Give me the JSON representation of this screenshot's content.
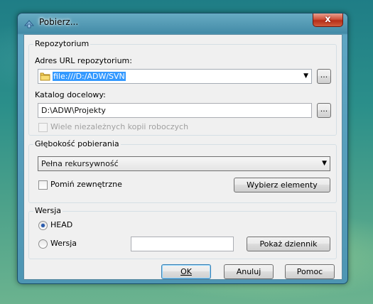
{
  "window": {
    "title": "Pobierz...",
    "close_glyph": "x"
  },
  "repository": {
    "group_label": "Repozytorium",
    "url_label": "Adres URL repozytorium:",
    "url_value": "file:///D:/ADW/SVN",
    "checkout_dir_label": "Katalog docelowy:",
    "checkout_dir_value": "D:\\ADW\\Projekty",
    "browse_glyph": "...",
    "multiple_copies_label": "Wiele niezależnych kopii roboczych"
  },
  "depth": {
    "group_label": "Głębokość pobierania",
    "selected": "Pełna rekursywność",
    "omit_externals_label": "Pomiń zewnętrzne",
    "choose_items_label": "Wybierz elementy"
  },
  "revision": {
    "group_label": "Wersja",
    "head_label": "HEAD",
    "revision_label": "Wersja",
    "revision_value": "",
    "show_log_label": "Pokaż dziennik"
  },
  "footer": {
    "ok_label": "OK",
    "cancel_label": "Anuluj",
    "help_label": "Pomoc"
  },
  "icons": {
    "title": "checkout-icon",
    "folder": "folder-icon",
    "dropdown": "chevron-down-icon"
  },
  "colors": {
    "selection": "#3399ff",
    "close_button": "#c9462c"
  }
}
